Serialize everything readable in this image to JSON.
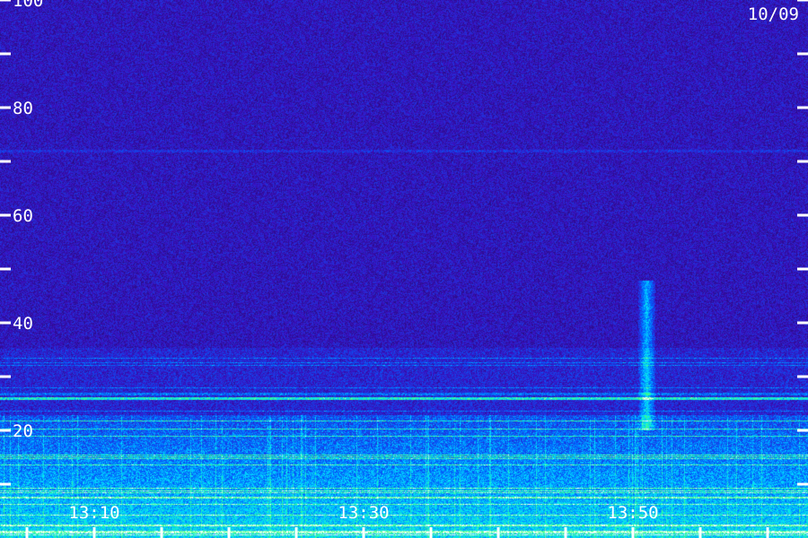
{
  "chart_data": {
    "type": "heatmap",
    "title": "",
    "xlabel": "",
    "ylabel": "",
    "date_label": "10/09",
    "x_range_minutes": [
      "13:03",
      "14:03"
    ],
    "x_tick_labels": [
      {
        "label": "13:10",
        "time": "13:10"
      },
      {
        "label": "13:30",
        "time": "13:30"
      },
      {
        "label": "13:50",
        "time": "13:50"
      }
    ],
    "x_major_ticks": [
      "13:05",
      "13:10",
      "13:15",
      "13:20",
      "13:25",
      "13:30",
      "13:35",
      "13:40",
      "13:45",
      "13:50",
      "13:55",
      "14:00"
    ],
    "ylim": [
      0,
      100
    ],
    "y_tick_labels": [
      20,
      40,
      60,
      80,
      100
    ],
    "y_major_ticks": [
      10,
      20,
      30,
      40,
      50,
      60,
      70,
      80,
      90,
      100
    ],
    "y_scale": "linear",
    "colormap": [
      "#1a0a4a",
      "#3a10c0",
      "#0060ff",
      "#00e0ff",
      "#40ff80",
      "#ffffff"
    ],
    "features": [
      {
        "kind": "strong-low-band",
        "y_range": [
          0,
          23
        ],
        "level": "high"
      },
      {
        "kind": "horizontal-line",
        "y": 26,
        "level": "medium"
      },
      {
        "kind": "horizontal-line",
        "y": 72,
        "level": "low"
      },
      {
        "kind": "vertical-burst",
        "time": "13:51",
        "y_range": [
          20,
          48
        ],
        "level": "medium"
      }
    ],
    "grid": false,
    "legend": "none"
  }
}
